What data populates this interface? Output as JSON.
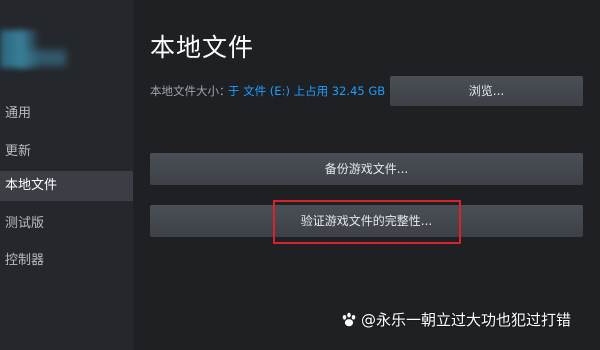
{
  "sidebar": {
    "items": [
      {
        "label": "通用",
        "active": false
      },
      {
        "label": "更新",
        "active": false
      },
      {
        "label": "本地文件",
        "active": true
      },
      {
        "label": "测试版",
        "active": false
      },
      {
        "label": "控制器",
        "active": false
      }
    ]
  },
  "main": {
    "title": "本地文件",
    "size_label": "本地文件大小：",
    "size_value": "于 文件 (E:) 上占用 32.45 GB",
    "browse_label": "浏览...",
    "backup_label": "备份游戏文件...",
    "verify_label": "验证游戏文件的完整性..."
  },
  "watermark": {
    "text": "@永乐一朝立过大功也犯过打错"
  },
  "colors": {
    "background": "#1e2023",
    "sidebar": "#24272c",
    "active_item": "#3b3f45",
    "accent": "#1a9fff",
    "highlight": "#d8232a"
  },
  "icons": {
    "watermark_icon": "paw-icon"
  }
}
